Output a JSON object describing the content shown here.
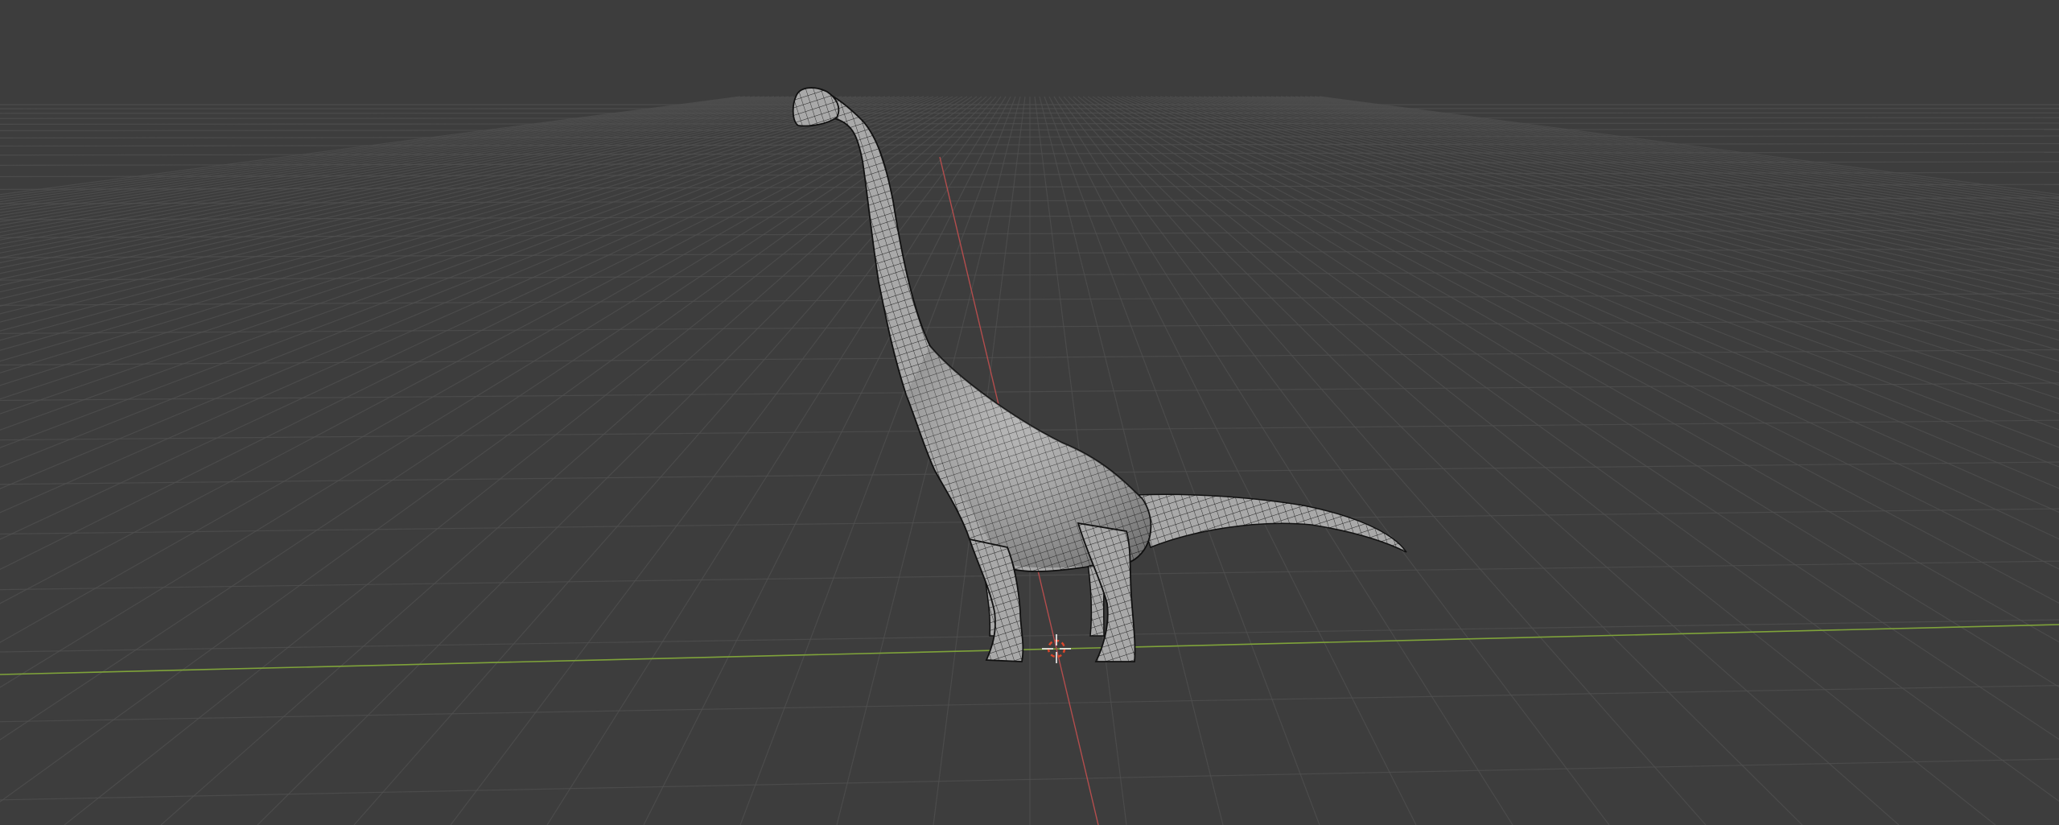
{
  "viewport": {
    "background_color": "#3d3d3d",
    "grid_color": "#505050",
    "x_axis_color": "#b34d4d",
    "y_axis_color": "#7fa33a",
    "grid_visible": true,
    "view_mode": "perspective"
  },
  "scene": {
    "object": {
      "name_hint": "brachiosaurus-model",
      "display": "wireframe-over-solid",
      "mesh_color": "#a8a8a8",
      "wire_color": "#1a1a1a"
    },
    "cursor_3d": {
      "color_primary": "#ffffff",
      "color_secondary": "#d9472b"
    }
  }
}
